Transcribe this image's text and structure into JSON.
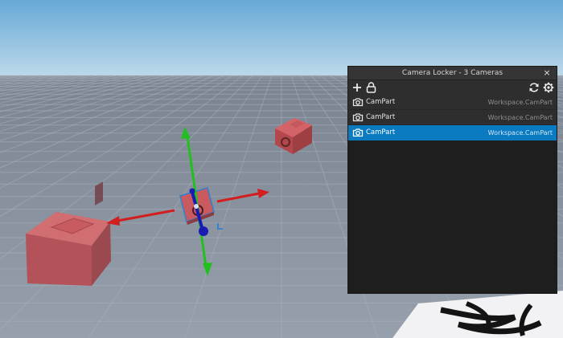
{
  "window": {
    "title": "Camera Locker - 3 Cameras",
    "close_label": "×"
  },
  "toolbar": {
    "add_icon": "plus-icon",
    "lock_icon": "lock-icon",
    "refresh_icon": "refresh-icon",
    "settings_icon": "gear-icon"
  },
  "cameras": [
    {
      "name": "CamPart",
      "path": "Workspace.CamPart",
      "selected": false
    },
    {
      "name": "CamPart",
      "path": "Workspace.CamPart",
      "selected": false
    },
    {
      "name": "CamPart",
      "path": "Workspace.CamPart",
      "selected": true
    }
  ],
  "colors": {
    "selection": "#0a7ac1",
    "x_axis": "#d21e1e",
    "y_axis": "#22c01e",
    "z_axis": "#1a1ab4",
    "part": "#c25257"
  }
}
